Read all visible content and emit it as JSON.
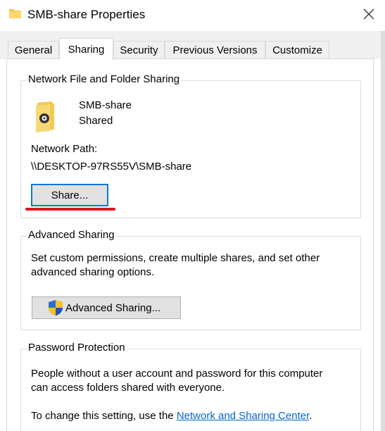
{
  "window": {
    "title": "SMB-share Properties",
    "folder_icon": "folder-icon",
    "close_icon": "close-icon"
  },
  "tabs": [
    {
      "label": "General"
    },
    {
      "label": "Sharing"
    },
    {
      "label": "Security"
    },
    {
      "label": "Previous Versions"
    },
    {
      "label": "Customize"
    }
  ],
  "network_sharing": {
    "group_label": "Network File and Folder Sharing",
    "folder_icon": "shared-folder-icon",
    "folder_name": "SMB-share",
    "folder_status": "Shared",
    "path_label": "Network Path:",
    "path_value": "\\\\DESKTOP-97RS55V\\SMB-share",
    "share_button": "Share..."
  },
  "advanced_sharing": {
    "group_label": "Advanced Sharing",
    "description_line1": "Set custom permissions, create multiple shares, and set other",
    "description_line2": "advanced sharing options.",
    "button_label": "Advanced Sharing...",
    "button_icon": "uac-shield-icon"
  },
  "password_protection": {
    "group_label": "Password Protection",
    "description_line1": "People without a user account and password for this computer",
    "description_line2": "can access folders shared with everyone.",
    "change_prefix": "To change this setting, use the ",
    "change_link": "Network and Sharing Center",
    "change_suffix": "."
  },
  "colors": {
    "accent": "#0078d7",
    "annotation_red": "#e0141e",
    "link": "#0066cc"
  }
}
